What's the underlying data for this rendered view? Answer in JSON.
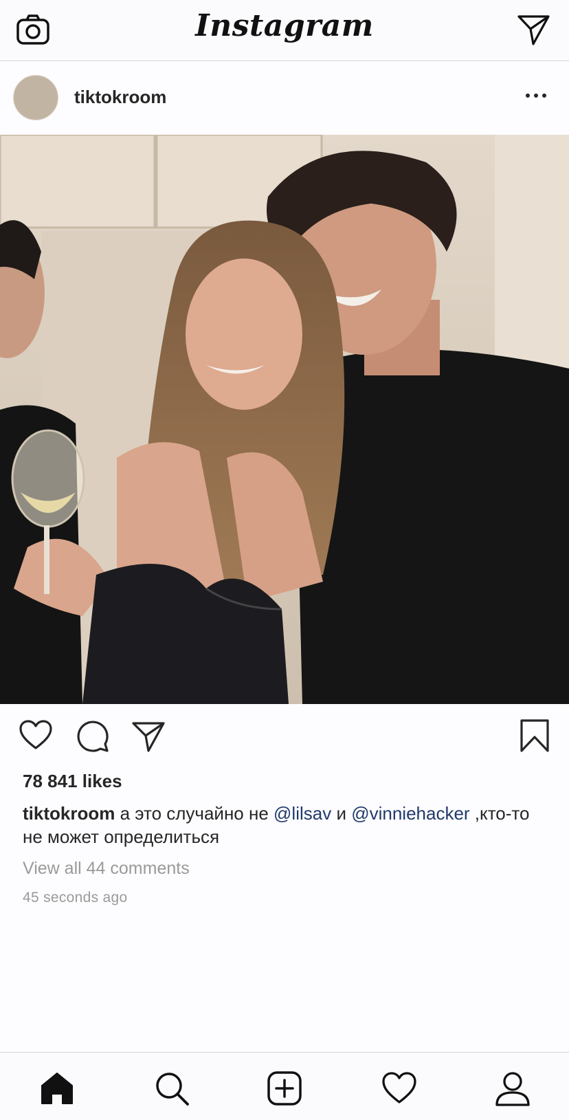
{
  "app": {
    "logo_text": "Instagram"
  },
  "header": {
    "left_icon": "camera-icon",
    "right_icon": "direct-send-icon"
  },
  "post": {
    "username": "tiktokroom",
    "more_icon": "more-options-icon",
    "image_alt": "Photo of three young people at a party; a girl in a black satin top holding a wine glass and a boy in a black sweater",
    "likes": "78 841 likes",
    "caption": {
      "user": "tiktokroom",
      "part1": " а это случайно не ",
      "mention1": "@lilsav",
      "part2": " и ",
      "mention2": "@vinniehacker",
      "part3": " ,кто-то не может определиться"
    },
    "comments_link": "View all 44 comments",
    "timestamp": "45 seconds ago"
  },
  "actions": [
    "heart-icon",
    "comment-icon",
    "share-icon",
    "bookmark-icon"
  ],
  "tabbar": [
    "home-icon",
    "search-icon",
    "new-post-icon",
    "activity-heart-icon",
    "profile-icon"
  ],
  "colors": {
    "text": "#262626",
    "mention": "#203a6b",
    "secondary": "#9a9a9a",
    "background": "#fdfcfe"
  }
}
